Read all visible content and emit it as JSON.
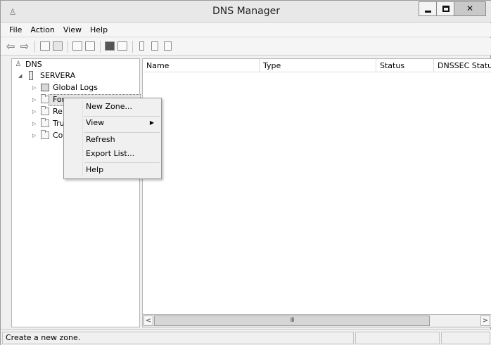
{
  "window": {
    "title": "DNS Manager"
  },
  "menubar": {
    "items": [
      "File",
      "Action",
      "View",
      "Help"
    ]
  },
  "toolbar": {
    "buttons": [
      "back-icon",
      "forward-icon",
      "up-folder-icon",
      "show-hide-console-tree-icon",
      "properties-icon",
      "export-list-icon",
      "help-icon",
      "show-action-pane-icon",
      "server-icon",
      "zone-icon",
      "record-icon"
    ]
  },
  "tree": {
    "root": "DNS",
    "server": "SERVERA",
    "nodes": [
      "Global Logs",
      "Forward Lookup Zones",
      "Reverse Lookup Zones",
      "Trust Points",
      "Conditional Forwarders"
    ],
    "visible_labels": [
      "Global Logs",
      "For",
      "Re",
      "Tru",
      "Co"
    ]
  },
  "list": {
    "columns": [
      "Name",
      "Type",
      "Status",
      "DNSSEC Status"
    ]
  },
  "context_menu": {
    "items": [
      "New Zone...",
      "View",
      "Refresh",
      "Export List...",
      "Help"
    ]
  },
  "scrollbar": {
    "left": "<",
    "right": ">",
    "grip": "III"
  },
  "status": {
    "text": "Create a new zone."
  }
}
